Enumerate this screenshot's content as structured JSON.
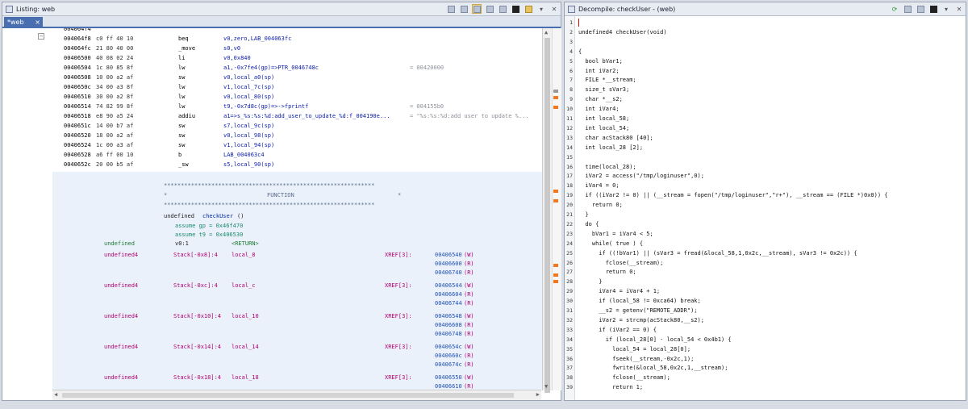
{
  "listing": {
    "title": "Listing: web",
    "tab_label": "*web",
    "tab_close": "×",
    "close": "✕",
    "gutter_marker": "−",
    "rows": [
      {
        "addr": "004064f4",
        "bytes": "",
        "mn": "",
        "ops": "",
        "cmt": ""
      },
      {
        "addr": "004064f8",
        "bytes": "c0 ff 40 10",
        "mn": "beq",
        "ops": "v0,zero,LAB_004063fc",
        "cmt": ""
      },
      {
        "addr": "004064fc",
        "bytes": "21 80 40 00",
        "mn": "_move",
        "ops": "s0,v0",
        "cmt": ""
      },
      {
        "addr": "00406500",
        "bytes": "40 08 02 24",
        "mn": "li",
        "ops": "v0,0x840",
        "cmt": ""
      },
      {
        "addr": "00406504",
        "bytes": "1c 80 85 8f",
        "mn": "lw",
        "ops": "a1,-0x7fe4(gp)=>PTR_0046748c",
        "cmt": "= 00420000"
      },
      {
        "addr": "00406508",
        "bytes": "10 00 a2 af",
        "mn": "sw",
        "ops": "v0,local_a0(sp)",
        "cmt": ""
      },
      {
        "addr": "0040650c",
        "bytes": "34 00 a3 8f",
        "mn": "lw",
        "ops": "v1,local_7c(sp)",
        "cmt": ""
      },
      {
        "addr": "00406510",
        "bytes": "30 00 a2 8f",
        "mn": "lw",
        "ops": "v0,local_80(sp)",
        "cmt": ""
      },
      {
        "addr": "00406514",
        "bytes": "74 82 99 8f",
        "mn": "lw",
        "ops": "t9,-0x7d8c(gp)=>->fprintf",
        "cmt": "= 004155b0"
      },
      {
        "addr": "00406518",
        "bytes": "e8 90 a5 24",
        "mn": "addiu",
        "ops": "a1=>s_%s:%s:%d:add_user_to_update_%d:f_004190e...",
        "cmt": "= \"%s:%s:%d:add user to update %..."
      },
      {
        "addr": "0040651c",
        "bytes": "14 00 b7 af",
        "mn": "sw",
        "ops": "s7,local_9c(sp)",
        "cmt": ""
      },
      {
        "addr": "00406520",
        "bytes": "18 00 a2 af",
        "mn": "sw",
        "ops": "v0,local_98(sp)",
        "cmt": ""
      },
      {
        "addr": "00406524",
        "bytes": "1c 00 a3 af",
        "mn": "sw",
        "ops": "v1,local_94(sp)",
        "cmt": ""
      },
      {
        "addr": "00406528",
        "bytes": "a6 ff 00 10",
        "mn": "b",
        "ops": "LAB_004063c4",
        "cmt": ""
      },
      {
        "addr": "0040652c",
        "bytes": "20 00 b5 af",
        "mn": "_sw",
        "ops": "s5,local_90(sp)",
        "cmt": ""
      }
    ],
    "function": {
      "stars": "**************************************************************",
      "edge_left": "*",
      "edge_right": "*",
      "label": "FUNCTION",
      "sig_type": "undefined",
      "sig_name": "checkUser",
      "sig_args": "()",
      "assume_gp": "assume gp = 0x46f470",
      "assume_t9": "assume t9 = 0x406530",
      "ret_type": "undefined",
      "ret_storage": "v0:1",
      "ret_label": "<RETURN>",
      "locals": [
        {
          "type": "undefined4",
          "storage": "Stack[-0x8]:4",
          "name": "local_8",
          "xref_label": "XREF[3]:",
          "xrefs": [
            {
              "a": "00406540",
              "k": "(W)"
            },
            {
              "a": "00406600",
              "k": "(R)"
            },
            {
              "a": "00406740",
              "k": "(R)"
            }
          ]
        },
        {
          "type": "undefined4",
          "storage": "Stack[-0xc]:4",
          "name": "local_c",
          "xref_label": "XREF[3]:",
          "xrefs": [
            {
              "a": "00406544",
              "k": "(W)"
            },
            {
              "a": "00406604",
              "k": "(R)"
            },
            {
              "a": "00406744",
              "k": "(R)"
            }
          ]
        },
        {
          "type": "undefined4",
          "storage": "Stack[-0x10]:4",
          "name": "local_10",
          "xref_label": "XREF[3]:",
          "xrefs": [
            {
              "a": "00406548",
              "k": "(W)"
            },
            {
              "a": "00406608",
              "k": "(R)"
            },
            {
              "a": "00406748",
              "k": "(R)"
            }
          ]
        },
        {
          "type": "undefined4",
          "storage": "Stack[-0x14]:4",
          "name": "local_14",
          "xref_label": "XREF[3]:",
          "xrefs": [
            {
              "a": "0040654c",
              "k": "(W)"
            },
            {
              "a": "0040660c",
              "k": "(R)"
            },
            {
              "a": "0040674c",
              "k": "(R)"
            }
          ]
        },
        {
          "type": "undefined4",
          "storage": "Stack[-0x18]:4",
          "name": "local_18",
          "xref_label": "XREF[3]:",
          "xrefs": [
            {
              "a": "00406550",
              "k": "(W)"
            },
            {
              "a": "00406610",
              "k": "(R)"
            }
          ]
        }
      ]
    }
  },
  "decompile": {
    "title": "Decompile: checkUser - (web)",
    "close": "✕",
    "lines": [
      "",
      "undefined4 checkUser(void)",
      "",
      "{",
      "  bool bVar1;",
      "  int iVar2;",
      "  FILE *__stream;",
      "  size_t sVar3;",
      "  char *__s2;",
      "  int iVar4;",
      "  int local_58;",
      "  int local_54;",
      "  char acStack80 [40];",
      "  int local_28 [2];",
      "",
      "  time(local_28);",
      "  iVar2 = access(\"/tmp/loginuser\",0);",
      "  iVar4 = 0;",
      "  if ((iVar2 != 0) || (__stream = fopen(\"/tmp/loginuser\",\"r+\"), __stream == (FILE *)0x0)) {",
      "    return 0;",
      "  }",
      "  do {",
      "    bVar1 = iVar4 < 5;",
      "    while( true ) {",
      "      if ((!bVar1) || (sVar3 = fread(&local_58,1,0x2c,__stream), sVar3 != 0x2c)) {",
      "        fclose(__stream);",
      "        return 0;",
      "      }",
      "      iVar4 = iVar4 + 1;",
      "      if (local_58 != 0xca64) break;",
      "      __s2 = getenv(\"REMOTE_ADDR\");",
      "      iVar2 = strcmp(acStack80,__s2);",
      "      if (iVar2 == 0) {",
      "        if (local_28[0] - local_54 < 0x4b1) {",
      "          local_54 = local_28[0];",
      "          fseek(__stream,-0x2c,1);",
      "          fwrite(&local_58,0x2c,1,__stream);",
      "          fclose(__stream);",
      "          return 1;"
    ]
  }
}
